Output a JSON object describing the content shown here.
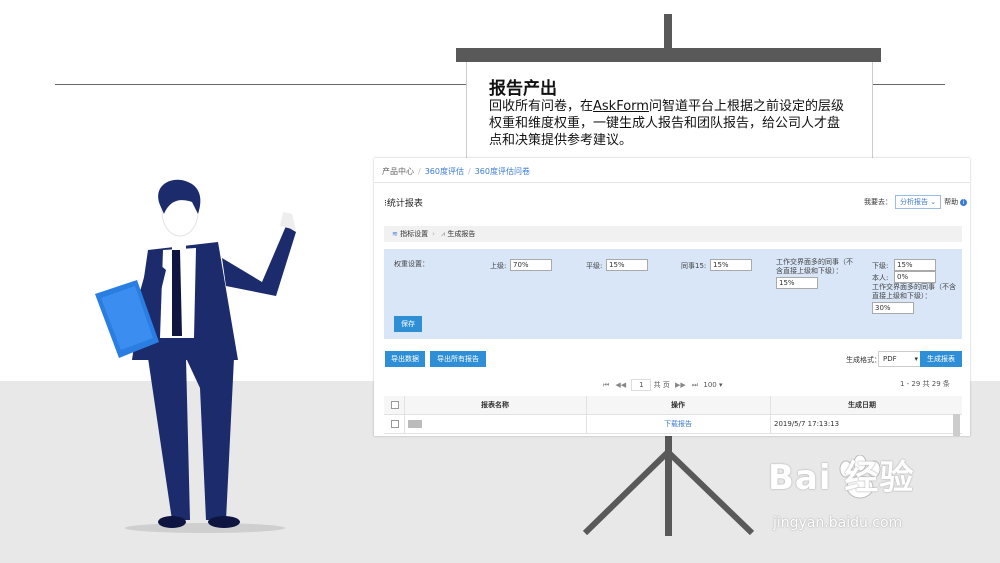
{
  "slide": {
    "title": "报告产出",
    "desc_pre": "回收所有问卷，在",
    "desc_link": "AskForm",
    "desc_post": "问智道平台上根据之前设定的层级权重和维度权重，一键生成人报告和团队报告，给公司人才盘点和决策提供参考建议。"
  },
  "ui": {
    "breadcrumb": [
      "产品中心",
      "360度评估",
      "360度评估问卷"
    ],
    "page_title": "统计报表",
    "goto_label": "我要去：",
    "goto_select": "分析报告 ⌄",
    "help_label": "帮助",
    "tabs": [
      "指标设置",
      "生成报告"
    ],
    "weights": {
      "label": "权重设置：",
      "upper_label": "上级:",
      "upper_value": "70%",
      "peer_label": "平级:",
      "peer_value": "15%",
      "colleague_label": "同事15:",
      "colleague_value": "15%",
      "cross_label": "工作交界面多的同事（不含直接上级和下级）：",
      "cross_value": "15%",
      "lower_label": "下级:",
      "lower_value": "15%",
      "self_label": "本人:",
      "self_value": "0%",
      "cross2_label": "工作交界面多的同事（不含直接上级和下级）：",
      "cross2_value": "30%"
    },
    "save_button": "保存",
    "export_data": "导出数据",
    "export_all": "导出所有报告",
    "format_label": "生成格式：",
    "format_value": "PDF",
    "generate_button": "生成报表",
    "pager": {
      "page": "1",
      "total_pages_label": "共 页",
      "page_size": "100",
      "range": "1 - 29  共 29 条"
    },
    "table": {
      "headers": [
        "报表名称",
        "操作",
        "生成日期"
      ],
      "rows": [
        {
          "action": "下载报告",
          "date": "2019/5/7 17:13:13"
        }
      ]
    }
  },
  "watermark": {
    "brand": "Bai 经验",
    "url": "jingyan.baidu.com"
  },
  "colors": {
    "primary": "#2f8fd6",
    "panel": "#d8e6f7",
    "suit": "#1c2b6b",
    "folder": "#2a7de1"
  }
}
